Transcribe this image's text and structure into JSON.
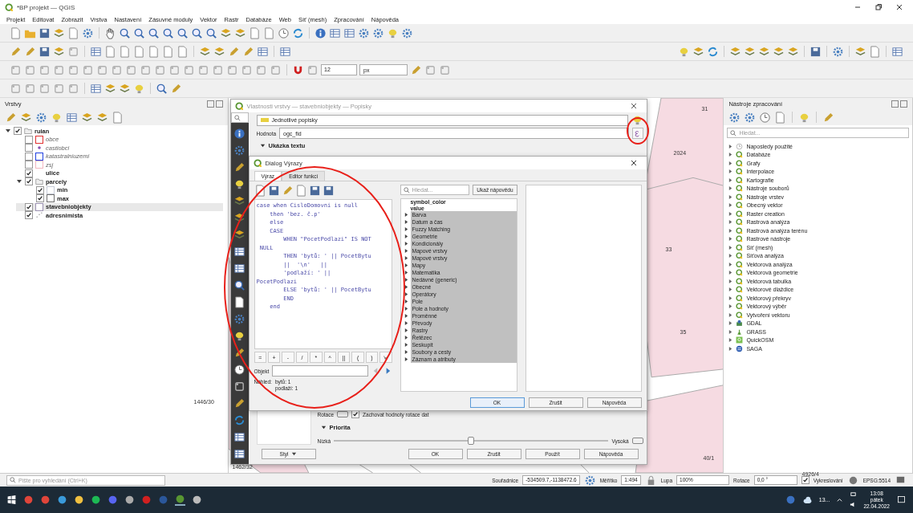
{
  "window": {
    "title": "*BP projekt — QGIS"
  },
  "menu": [
    "Projekt",
    "Editovat",
    "Zobrazit",
    "Vrstva",
    "Nastavení",
    "Zásuvné moduly",
    "Vektor",
    "Rastr",
    "Databáze",
    "Web",
    "Síť (mesh)",
    "Zpracování",
    "Nápověda"
  ],
  "snapping": {
    "tolerance": "12",
    "unit": "px"
  },
  "layers_panel": {
    "title": "Vrstvy",
    "tree": [
      {
        "label": "ruian",
        "checked": true,
        "expanded": true,
        "selected": false,
        "kind": "group",
        "children": [
          {
            "label": "obce",
            "checked": false,
            "selected": false,
            "kind": "polygon",
            "color": "#e03030"
          },
          {
            "label": "castiobci",
            "checked": false,
            "selected": false,
            "kind": "point",
            "color": "#8a4fb0"
          },
          {
            "label": "katastralniuzemi",
            "checked": false,
            "selected": false,
            "kind": "polygon",
            "color": "#2040e0"
          },
          {
            "label": "zsj",
            "checked": false,
            "selected": false,
            "kind": "polygon",
            "color": "#f2b8c0"
          },
          {
            "label": "ulice",
            "checked": true,
            "selected": false,
            "kind": "none"
          },
          {
            "label": "parcely",
            "checked": true,
            "expanded": true,
            "selected": false,
            "kind": "group",
            "children": [
              {
                "label": "min",
                "checked": true,
                "selected": false,
                "kind": "polygon",
                "color": "#c8ccd8"
              },
              {
                "label": "max",
                "checked": true,
                "selected": false,
                "kind": "polygon",
                "color": "#707070"
              }
            ]
          },
          {
            "label": "stavebniobjekty",
            "checked": true,
            "selected": true,
            "kind": "polygon",
            "color": "#9a90b0"
          },
          {
            "label": "adresnimista",
            "checked": true,
            "selected": false,
            "kind": "dots"
          }
        ]
      }
    ]
  },
  "map": {
    "labels": [
      "2024",
      "31",
      "33",
      "35",
      "1446/30",
      "1462/32",
      "40/1",
      "4926/4"
    ]
  },
  "layer_properties": {
    "title": "Vlastnosti vrstvy — stavebniobjekty — Popisky",
    "mode": "Jednotlivé popisky",
    "value_label": "Hodnota",
    "value": "ogc_fid",
    "section": "Ukázka textu",
    "rotation_label": "Rotace",
    "keep_rotation": {
      "label": "Zachovat hodnoty rotace dat",
      "checked": true
    },
    "priority": {
      "title": "Priorita",
      "low": "Nízká",
      "high": "Vysoká",
      "level": 0.5
    },
    "style_button": "Styl",
    "buttons": [
      "OK",
      "Zrušit",
      "Použít",
      "Nápověda"
    ]
  },
  "expression_dialog": {
    "title": "Dialog Výrazy",
    "tabs": [
      {
        "label": "Výraz",
        "selected": true
      },
      {
        "label": "Editor funkcí",
        "selected": false
      }
    ],
    "code": [
      "case when CisloDomovni is null",
      "    then 'bez. č.p'",
      "    else",
      "    CASE",
      "        WHEN \"PocetPodlazi\" IS NOT",
      " NULL",
      "        THEN 'bytů: ' || PocetBytu",
      "        ||  '\\n'   ||",
      "        'podlaží: ' ||",
      "PocetPodlazi",
      "        ELSE 'bytů: ' || PocetBytu",
      "        END",
      "    end"
    ],
    "operators": [
      "=",
      "+",
      "-",
      "/",
      "*",
      "^",
      "||",
      "(",
      ")"
    ],
    "object_label": "Objekt",
    "preview_label": "Náhled:",
    "preview": [
      "bytů: 1",
      "podlaží: 1"
    ],
    "search": {
      "placeholder": "Hledat..."
    },
    "help_button": "Ukaž nápovědu",
    "fields": [
      "symbol_color",
      "value"
    ],
    "groups": [
      "Barva",
      "Datum a čas",
      "Fuzzy Matching",
      "Geometrie",
      "Kondicionály",
      "Mapové vrstvy",
      "Mapové vrstvy",
      "Mapy",
      "Matematika",
      "Nedávné (generic)",
      "Obecné",
      "Operátory",
      "Pole",
      "Pole a hodnoty",
      "Proměnné",
      "Převody",
      "Rastry",
      "Řetězec",
      "Seskupit",
      "Soubory a cesty",
      "Záznam a atributy"
    ],
    "buttons": [
      "OK",
      "Zrušit",
      "Nápověda"
    ]
  },
  "processing_panel": {
    "title": "Nástroje zpracování",
    "search": {
      "placeholder": "Hledat..."
    },
    "items": [
      {
        "label": "Naposledy použité",
        "kind": "recent"
      },
      {
        "label": "Databáze",
        "kind": "qgis"
      },
      {
        "label": "Grafy",
        "kind": "qgis"
      },
      {
        "label": "Interpolace",
        "kind": "qgis"
      },
      {
        "label": "Kartografie",
        "kind": "qgis"
      },
      {
        "label": "Nástroje souborů",
        "kind": "qgis"
      },
      {
        "label": "Nástroje vrstev",
        "kind": "qgis"
      },
      {
        "label": "Obecný vektor",
        "kind": "qgis"
      },
      {
        "label": "Raster creation",
        "kind": "qgis"
      },
      {
        "label": "Rastrová analýza",
        "kind": "qgis"
      },
      {
        "label": "Rastrová analýza terénu",
        "kind": "qgis"
      },
      {
        "label": "Rastrové nástroje",
        "kind": "qgis"
      },
      {
        "label": "Síť (mesh)",
        "kind": "qgis"
      },
      {
        "label": "Síťová analýza",
        "kind": "qgis"
      },
      {
        "label": "Vektorová analýza",
        "kind": "qgis"
      },
      {
        "label": "Vektorová geometrie",
        "kind": "qgis"
      },
      {
        "label": "Vektorová tabulka",
        "kind": "qgis"
      },
      {
        "label": "Vektorové dlaždice",
        "kind": "qgis"
      },
      {
        "label": "Vektorový překryv",
        "kind": "qgis"
      },
      {
        "label": "Vektorový výběr",
        "kind": "qgis"
      },
      {
        "label": "Vytvoření vektoru",
        "kind": "qgis"
      },
      {
        "label": "GDAL",
        "kind": "gdal"
      },
      {
        "label": "GRASS",
        "kind": "grass"
      },
      {
        "label": "QuickOSM",
        "kind": "quickosm"
      },
      {
        "label": "SAGA",
        "kind": "saga"
      }
    ]
  },
  "status_bar": {
    "search_placeholder": "Pište pro vyhledání (Ctrl+K)",
    "coord_label": "Souřadnice",
    "coords": "-534509.7,-1138472.6",
    "scale_label": "Měřítko",
    "scale": "1:494",
    "zoom_label": "Lupa",
    "zoom": "100%",
    "rotation_label": "Rotace",
    "rotation": "0,0 °",
    "render": {
      "label": "Vykreslování",
      "checked": true
    },
    "crs": "EPSG:5514"
  },
  "taskbar": {
    "tray_text": "13...",
    "time": "13:08",
    "day": "pátek",
    "date": "22.04.2022"
  }
}
